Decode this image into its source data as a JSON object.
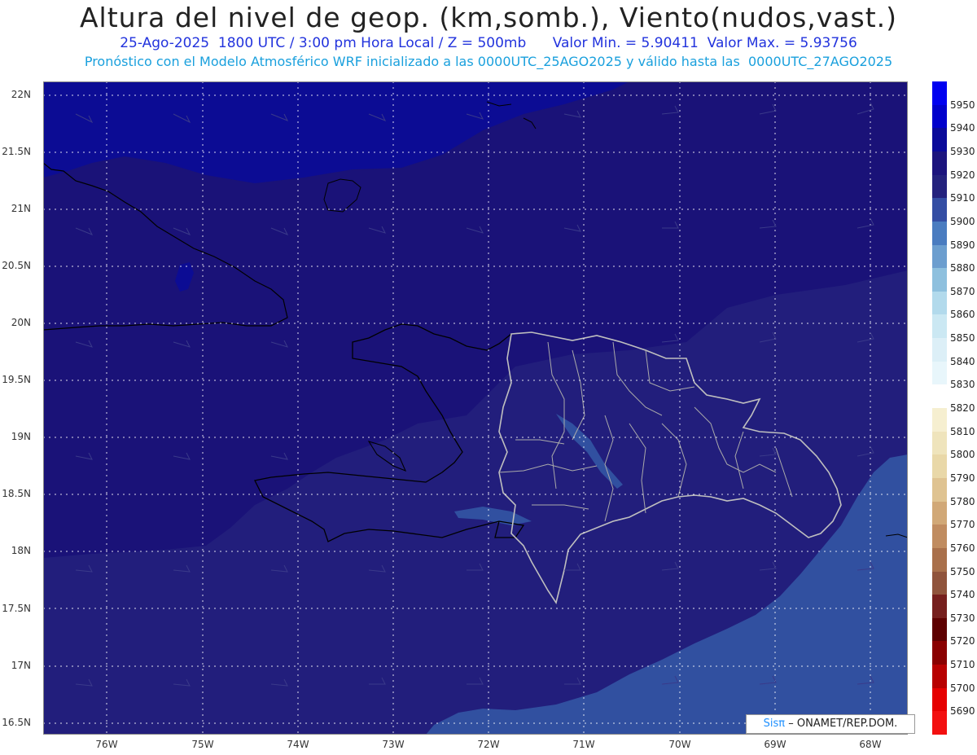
{
  "title": "Altura del nivel de geop. (km,somb.), Viento(nudos,vast.)",
  "subtitle_date": "25-Ago-2025  1800 UTC / 3:00 pm Hora Local / Z = 500mb",
  "subtitle_range": "Valor Min. = 5.90411  Valor Max. = 5.93756",
  "subtitle_model": "Pronóstico con el Modelo Atmosférico WRF inicializado a las 0000UTC_25AGO2025 y válido hasta las  0000UTC_27AGO2025",
  "lat_labels": [
    "22N",
    "21.5N",
    "21N",
    "20.5N",
    "20N",
    "19.5N",
    "19N",
    "18.5N",
    "18N",
    "17.5N",
    "17N",
    "16.5N"
  ],
  "lon_labels": [
    "76W",
    "75W",
    "74W",
    "73W",
    "72W",
    "71W",
    "70W",
    "69W",
    "68W"
  ],
  "colorbar": {
    "labels": [
      "5950",
      "5940",
      "5930",
      "5920",
      "5910",
      "5900",
      "5890",
      "5880",
      "5870",
      "5860",
      "5850",
      "5840",
      "5830",
      "5820",
      "5810",
      "5800",
      "5790",
      "5780",
      "5770",
      "5760",
      "5750",
      "5740",
      "5730",
      "5720",
      "5710",
      "5700",
      "5690"
    ],
    "colors": [
      "#0000f0",
      "#0000cc",
      "#0a0a9a",
      "#1c147e",
      "#24227e",
      "#344ea4",
      "#4a7cc0",
      "#6c9ecf",
      "#8ec0de",
      "#b2daec",
      "#cbe8f3",
      "#dceff7",
      "#e8f6fb",
      "#ffffff",
      "#f6efd0",
      "#efe4bc",
      "#e9d8a8",
      "#dfc391",
      "#d1a877",
      "#c08c60",
      "#a9704b",
      "#90543c",
      "#761f1d",
      "#5e0000",
      "#8a0000",
      "#b80000",
      "#e60000",
      "#f31010"
    ]
  },
  "credit_logo": "Sisπ",
  "credit_text": "– ONAMET/REP.DOM.",
  "colors": {
    "field_5930": "#0c0c94",
    "field_5920": "#1a1278",
    "field_5910": "#221e7c",
    "field_5900": "#3150a0",
    "field_5890": "#4a7cc0"
  }
}
